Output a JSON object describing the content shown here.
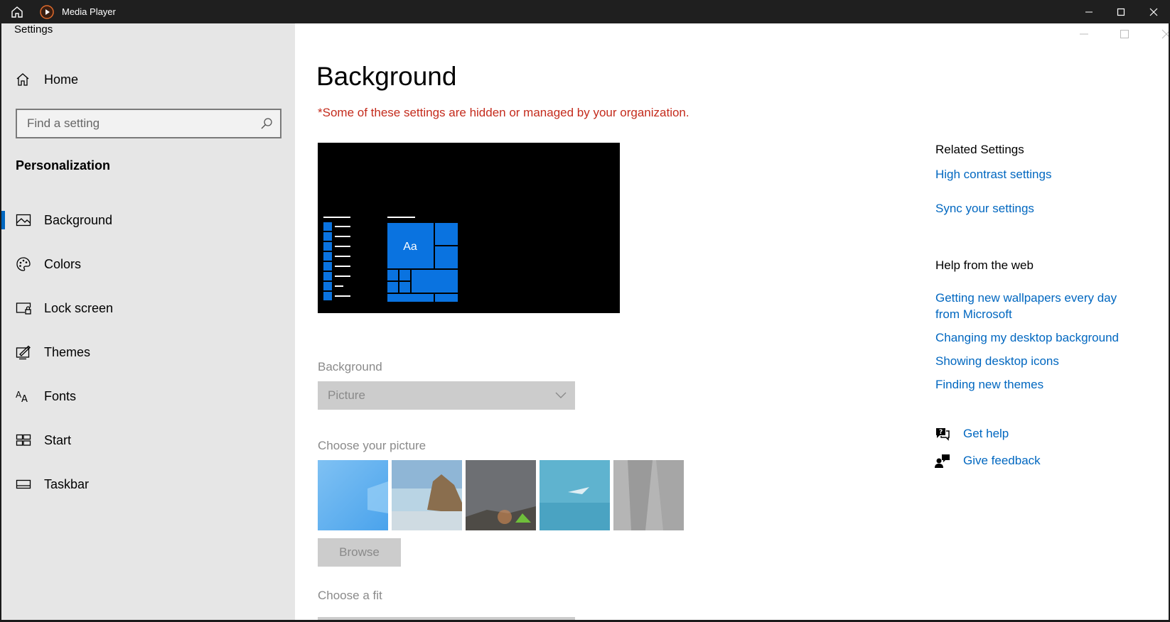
{
  "outer_window": {
    "title": "Media Player",
    "icons": [
      "home-icon",
      "media-player-icon"
    ],
    "controls": [
      "minimize-icon",
      "maximize-icon",
      "close-icon"
    ]
  },
  "settings": {
    "window_title": "Settings",
    "home_label": "Home",
    "search_placeholder": "Find a setting",
    "section_title": "Personalization",
    "nav_items": [
      {
        "label": "Background",
        "icon": "picture-icon",
        "selected": true
      },
      {
        "label": "Colors",
        "icon": "palette-icon"
      },
      {
        "label": "Lock screen",
        "icon": "lock-screen-icon"
      },
      {
        "label": "Themes",
        "icon": "themes-icon"
      },
      {
        "label": "Fonts",
        "icon": "fonts-icon"
      },
      {
        "label": "Start",
        "icon": "start-icon"
      },
      {
        "label": "Taskbar",
        "icon": "taskbar-icon"
      }
    ]
  },
  "main": {
    "title": "Background",
    "warning": "*Some of these settings are hidden or managed by your organization.",
    "preview_tile_text": "Aa",
    "background_label": "Background",
    "background_value": "Picture",
    "choose_picture_label": "Choose your picture",
    "browse_label": "Browse",
    "choose_fit_label": "Choose a fit"
  },
  "related": {
    "heading": "Related Settings",
    "links": [
      "High contrast settings",
      "Sync your settings"
    ],
    "help_heading": "Help from the web",
    "help_links": [
      "Getting new wallpapers every day from Microsoft",
      "Changing my desktop background",
      "Showing desktop icons",
      "Finding new themes"
    ],
    "get_help": "Get help",
    "give_feedback": "Give feedback"
  },
  "colors": {
    "accent": "#0067c0",
    "warning": "#c42b1c",
    "tile_blue": "#0a73e0",
    "sidebar_bg": "#e6e6e6"
  }
}
